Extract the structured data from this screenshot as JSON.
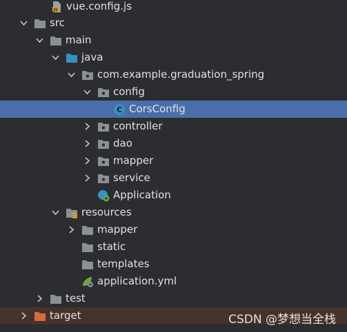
{
  "colors": {
    "background": "#2b2d30",
    "selection": "#4a6ea9",
    "excluded_row": "#45322b",
    "folder": "#8c8f94",
    "source_folder": "#3592c4",
    "excluded_folder": "#d66b3b",
    "class_icon": "#3592c4",
    "spring_icon": "#6ea644"
  },
  "tree": [
    {
      "label": "vue.config.js",
      "icon": "js-file-icon"
    },
    {
      "label": "src",
      "icon": "folder-icon",
      "expanded": true
    },
    {
      "label": "main",
      "icon": "folder-icon",
      "expanded": true
    },
    {
      "label": "java",
      "icon": "source-folder-icon",
      "expanded": true
    },
    {
      "label": "com.example.graduation_spring",
      "icon": "package-icon",
      "expanded": true
    },
    {
      "label": "config",
      "icon": "package-icon",
      "expanded": true
    },
    {
      "label": "CorsConfig",
      "icon": "class-icon",
      "selected": true
    },
    {
      "label": "controller",
      "icon": "package-icon",
      "expanded": false
    },
    {
      "label": "dao",
      "icon": "package-icon",
      "expanded": false
    },
    {
      "label": "mapper",
      "icon": "package-icon",
      "expanded": false
    },
    {
      "label": "service",
      "icon": "package-icon",
      "expanded": false
    },
    {
      "label": "Application",
      "icon": "spring-boot-class-icon"
    },
    {
      "label": "resources",
      "icon": "resources-folder-icon",
      "expanded": true
    },
    {
      "label": "mapper",
      "icon": "folder-icon",
      "expanded": false
    },
    {
      "label": "static",
      "icon": "folder-icon"
    },
    {
      "label": "templates",
      "icon": "folder-icon"
    },
    {
      "label": "application.yml",
      "icon": "spring-config-icon"
    },
    {
      "label": "test",
      "icon": "folder-icon",
      "expanded": false
    },
    {
      "label": "target",
      "icon": "excluded-folder-icon",
      "expanded": false
    }
  ],
  "watermark": "CSDN @梦想当全栈"
}
